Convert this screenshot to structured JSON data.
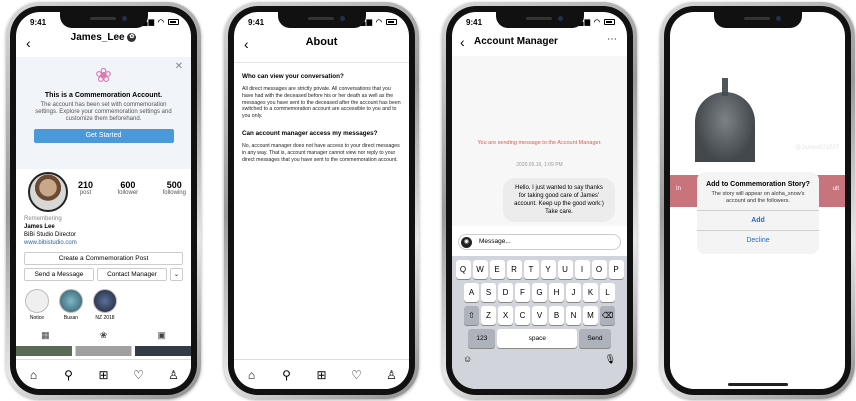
{
  "phone1": {
    "time": "9:41",
    "username": "James_Lee",
    "banner_title": "This is a Commemoration Account.",
    "banner_desc": "The account has been set with commemoration settings. Explore your commemoration settings and customize them beforehand.",
    "banner_button": "Get Started",
    "stats": [
      {
        "value": "210",
        "label": "post"
      },
      {
        "value": "600",
        "label": "follower"
      },
      {
        "value": "500",
        "label": "following"
      }
    ],
    "remembering": "Remembering",
    "name": "James Lee",
    "role": "BiBi Studio Director",
    "link": "www.bibistudio.com",
    "create_post": "Create a Commemoration Post",
    "send_message": "Send a Message",
    "contact_manager": "Contact Manager",
    "highlights": [
      "Notice",
      "Busan",
      "NZ 2018"
    ]
  },
  "phone2": {
    "time": "9:41",
    "title": "About",
    "q1": "Who can view your conversation?",
    "a1": "All direct messages are strictly private. All conversations that you have had with the deceased before his or her death as well as the messages you have sent to the deceased after the account has been switched to a commemoration account are accessible to you and to you only.",
    "q2": "Can account manager access my messages?",
    "a2": "No, account manager does not have access to your direct messages in any way. That is, account manager cannot view nor reply to your direct messages that you have sent to the commemoration account."
  },
  "phone3": {
    "time": "9:41",
    "title": "Account Manager",
    "system_msg": "You are sending message to the Account Manager.",
    "timestamp": "2020.05.16, 1:09 PM",
    "bubble": "Hello. I just wanted to say thanks for taking good care of James' account. Keep up the good work:) Take care.",
    "input_placeholder": "Message...",
    "row1": [
      "Q",
      "W",
      "E",
      "R",
      "T",
      "Y",
      "U",
      "I",
      "O",
      "P"
    ],
    "row2": [
      "A",
      "S",
      "D",
      "F",
      "G",
      "H",
      "J",
      "K",
      "L"
    ],
    "row3": [
      "Z",
      "X",
      "C",
      "V",
      "B",
      "N",
      "M"
    ],
    "key_123": "123",
    "key_space": "space",
    "key_send": "Send"
  },
  "phone4": {
    "time": "9:41",
    "handle": "@James021007",
    "bg_left": "In",
    "bg_right": "ult",
    "dialog_title": "Add to Commemoration Story?",
    "dialog_msg": "The story will appear on aloha_snow's account and the followers.",
    "add": "Add",
    "decline": "Decline"
  }
}
